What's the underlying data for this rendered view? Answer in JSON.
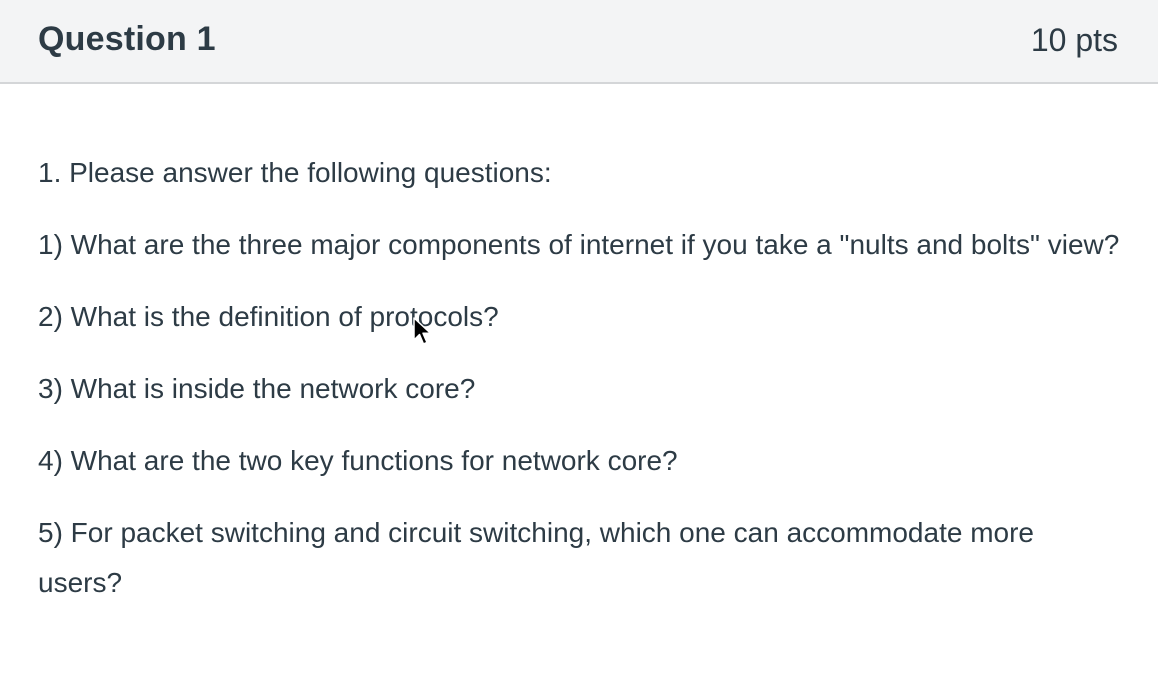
{
  "question": {
    "title": "Question 1",
    "points": "10 pts",
    "intro": "1. Please answer the following questions:",
    "items": [
      "1) What are the three major components of internet if you take a \"nults and bolts\" view?",
      "2) What is the definition of protocols?",
      "3) What is inside the network core?",
      "4) What are the two key functions for network core?",
      "5) For packet switching and circuit switching, which one can accommodate more users?"
    ]
  },
  "icons": {
    "cursor": "mouse-pointer-icon"
  }
}
